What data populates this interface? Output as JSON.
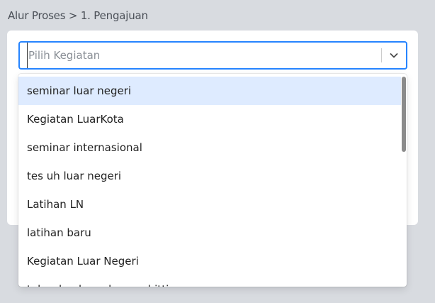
{
  "breadcrumb": {
    "text": "Alur Proses > 1. Pengajuan"
  },
  "select": {
    "placeholder": "Pilih Kegiatan",
    "chevron_icon": "chevron-down-icon",
    "accent_color": "#2684ff"
  },
  "menu": {
    "focused_color": "#deebff",
    "items": [
      {
        "label": "seminar luar negeri"
      },
      {
        "label": "Kegiatan LuarKota"
      },
      {
        "label": "seminar internasional"
      },
      {
        "label": "tes uh luar negeri"
      },
      {
        "label": "Latihan LN"
      },
      {
        "label": "latihan baru"
      },
      {
        "label": "Kegiatan Luar Negeri"
      },
      {
        "label": "takes lomba pokemon bitti"
      }
    ]
  }
}
